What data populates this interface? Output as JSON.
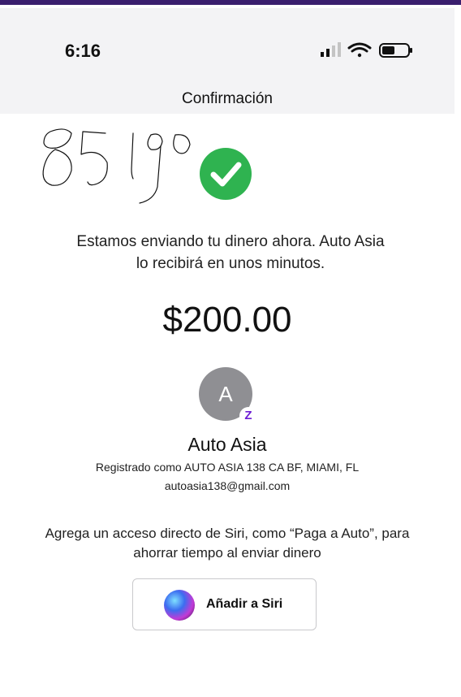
{
  "status_bar": {
    "time": "6:16",
    "icons": [
      "signal-icon",
      "wifi-icon",
      "battery-icon"
    ]
  },
  "nav": {
    "title": "Confirmación"
  },
  "handwritten_note": "85190",
  "confirmation": {
    "message_line1": "Estamos enviando tu dinero ahora. Auto Asia",
    "message_line2": "lo recibirá en unos minutos.",
    "amount": "$200.00"
  },
  "recipient": {
    "avatar_initial": "A",
    "badge": "Z",
    "name": "Auto Asia",
    "registered_as": "Registrado como AUTO ASIA 138 CA BF, MIAMI, FL",
    "email": "autoasia138@gmail.com"
  },
  "siri": {
    "note_line1": "Agrega un acceso directo de Siri, como “Paga a Auto”, para",
    "note_line2": "ahorrar tiempo al enviar dinero",
    "button_label": "Añadir a Siri"
  },
  "colors": {
    "accent_purple": "#6d1ed4",
    "check_green": "#2fb350",
    "avatar_gray": "#8f8f93"
  }
}
